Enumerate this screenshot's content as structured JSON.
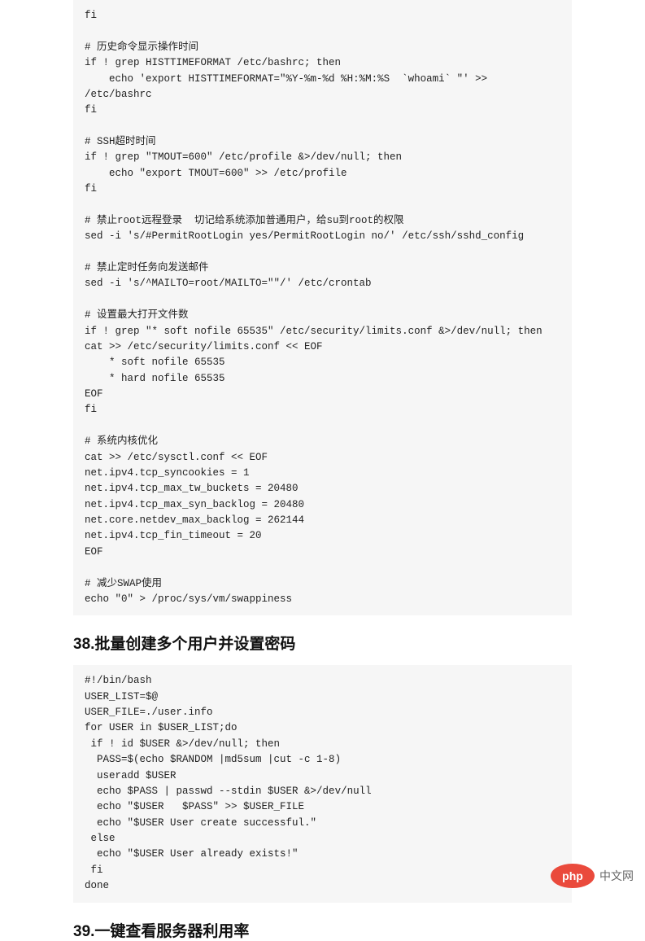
{
  "code_block_1": "fi\n\n# 历史命令显示操作时间\nif ! grep HISTTIMEFORMAT /etc/bashrc; then\n    echo 'export HISTTIMEFORMAT=\"%Y-%m-%d %H:%M:%S  `whoami` \"' >> /etc/bashrc\nfi\n\n# SSH超时时间\nif ! grep \"TMOUT=600\" /etc/profile &>/dev/null; then\n    echo \"export TMOUT=600\" >> /etc/profile\nfi\n\n# 禁止root远程登录  切记给系统添加普通用户，给su到root的权限\nsed -i 's/#PermitRootLogin yes/PermitRootLogin no/' /etc/ssh/sshd_config\n\n# 禁止定时任务向发送邮件\nsed -i 's/^MAILTO=root/MAILTO=\"\"/' /etc/crontab\n\n# 设置最大打开文件数\nif ! grep \"* soft nofile 65535\" /etc/security/limits.conf &>/dev/null; then\ncat >> /etc/security/limits.conf << EOF\n    * soft nofile 65535\n    * hard nofile 65535\nEOF\nfi\n\n# 系统内核优化\ncat >> /etc/sysctl.conf << EOF\nnet.ipv4.tcp_syncookies = 1\nnet.ipv4.tcp_max_tw_buckets = 20480\nnet.ipv4.tcp_max_syn_backlog = 20480\nnet.core.netdev_max_backlog = 262144\nnet.ipv4.tcp_fin_timeout = 20\nEOF\n\n# 减少SWAP使用\necho \"0\" > /proc/sys/vm/swappiness",
  "heading_38": "38.批量创建多个用户并设置密码",
  "code_block_2": "#!/bin/bash\nUSER_LIST=$@\nUSER_FILE=./user.info\nfor USER in $USER_LIST;do\n if ! id $USER &>/dev/null; then\n  PASS=$(echo $RANDOM |md5sum |cut -c 1-8)\n  useradd $USER\n  echo $PASS | passwd --stdin $USER &>/dev/null\n  echo \"$USER   $PASS\" >> $USER_FILE\n  echo \"$USER User create successful.\"\n else\n  echo \"$USER User already exists!\"\n fi\ndone",
  "heading_39": "39.一键查看服务器利用率",
  "logo": {
    "text": "php",
    "label": "中文网"
  }
}
